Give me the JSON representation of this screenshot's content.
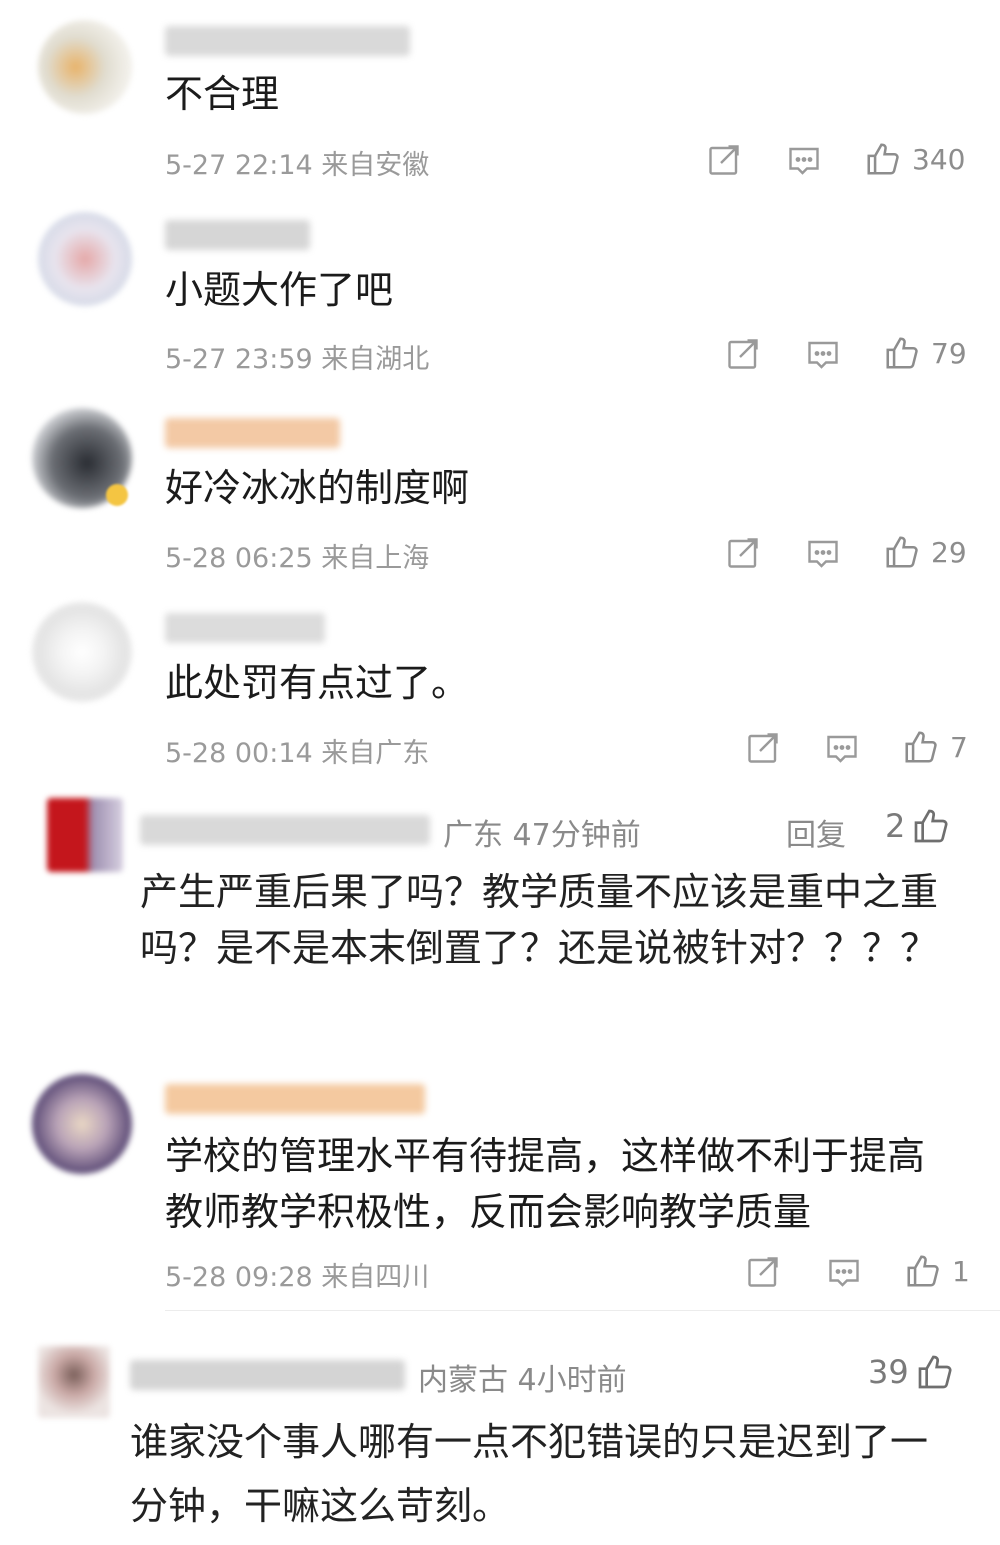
{
  "comments": [
    {
      "text": "不合理",
      "time": "5-27 22:14",
      "loc": "来自安徽",
      "likes": "340"
    },
    {
      "text": "小题大作了吧",
      "time": "5-27 23:59",
      "loc": "来自湖北",
      "likes": "79"
    },
    {
      "text": "好冷冰冰的制度啊",
      "time": "5-28 06:25",
      "loc": "来自上海",
      "likes": "29"
    },
    {
      "text": "此处罚有点过了。",
      "time": "5-28 00:14",
      "loc": "来自广东",
      "likes": "7"
    },
    {
      "text": "学校的管理水平有待提高，这样做不利于提高教师教学积极性，反而会影响教学质量",
      "time": "5-28 09:28",
      "loc": "来自四川",
      "likes": "1"
    }
  ],
  "alt_comments": [
    {
      "region": "广东 47分钟前",
      "reply": "回复",
      "likes": "2",
      "text": "产生严重后果了吗？教学质量不应该是重中之重吗？是不是本末倒置了？还是说被针对？？？？"
    },
    {
      "region": "内蒙古 4小时前",
      "likes": "39",
      "text": "谁家没个事人哪有一点不犯错误的只是迟到了一分钟，干嘛这么苛刻。"
    }
  ],
  "icons": [
    "share-icon",
    "comment-icon",
    "thumbs-up-icon"
  ]
}
